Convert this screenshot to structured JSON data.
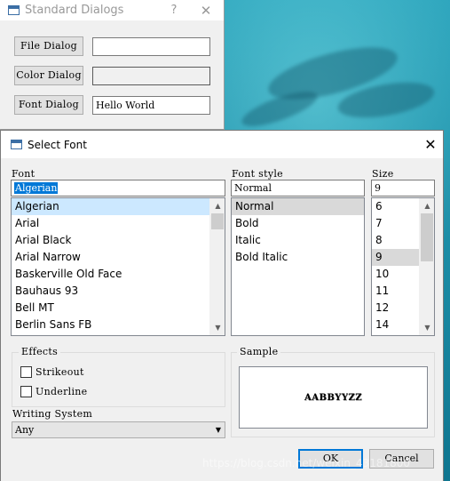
{
  "standard_dialogs": {
    "title": "Standard Dialogs",
    "help_glyph": "?",
    "close_glyph": "✕",
    "file_dialog_label": "File Dialog",
    "file_value": "",
    "color_dialog_label": "Color Dialog",
    "color_value": "",
    "font_dialog_label": "Font Dialog",
    "font_value": "Hello World"
  },
  "font_dialog": {
    "title": "Select Font",
    "close_glyph": "✕",
    "font_label": "Font",
    "font_value": "Algerian",
    "fonts": [
      "Algerian",
      "Arial",
      "Arial Black",
      "Arial Narrow",
      "Baskerville Old Face",
      "Bauhaus 93",
      "Bell MT",
      "Berlin Sans FB"
    ],
    "selected_font": "Algerian",
    "style_label": "Font style",
    "style_value": "Normal",
    "styles": [
      "Normal",
      "Bold",
      "Italic",
      "Bold Italic"
    ],
    "selected_style": "Normal",
    "size_label": "Size",
    "size_value": "9",
    "sizes": [
      "6",
      "7",
      "8",
      "9",
      "10",
      "11",
      "12",
      "14"
    ],
    "selected_size": "9",
    "effects_label": "Effects",
    "strikeout_label": "Strikeout",
    "strikeout_checked": false,
    "underline_label": "Underline",
    "underline_checked": false,
    "writing_system_label": "Writing System",
    "writing_system_value": "Any",
    "sample_label": "Sample",
    "sample_text": "AABBYYZZ",
    "ok_label": "OK",
    "cancel_label": "Cancel"
  },
  "watermark": "https://blog.csdn.net/weixin_43181800",
  "colors": {
    "selection_blue": "#0078d7",
    "list_selection_light": "#cce8ff",
    "list_selection_gray": "#d9d9d9",
    "dialog_bg": "#f0f0f0"
  }
}
